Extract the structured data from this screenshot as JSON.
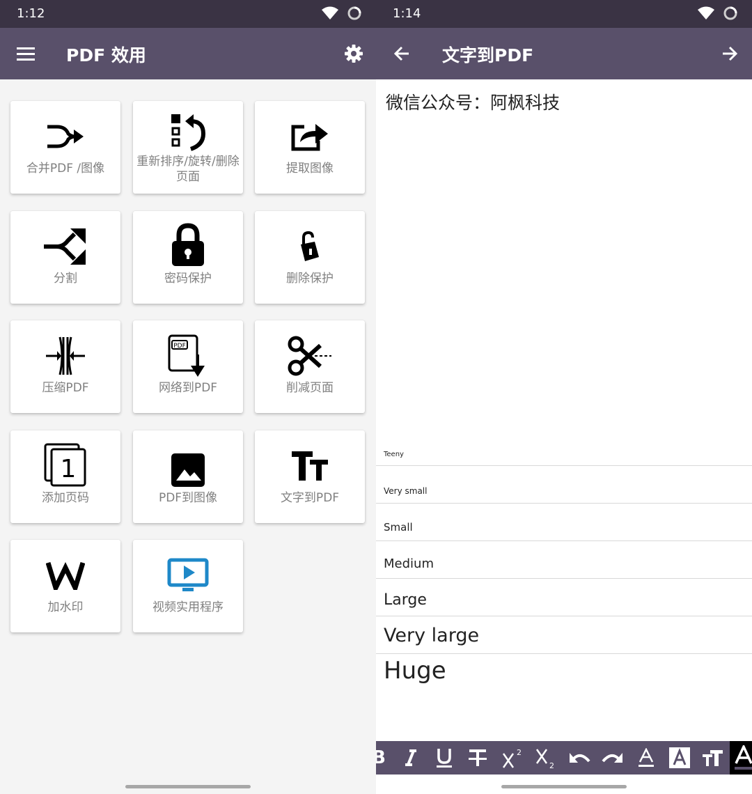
{
  "left_screen": {
    "status": {
      "time": "1:12"
    },
    "appbar": {
      "title": "PDF 效用"
    },
    "tiles": [
      {
        "label": "合并PDF /图像",
        "icon": "merge-icon"
      },
      {
        "label": "重新排序/旋转/删除页面",
        "icon": "reorder-rotate-icon"
      },
      {
        "label": "提取图像",
        "icon": "share-icon"
      },
      {
        "label": "分割",
        "icon": "split-icon"
      },
      {
        "label": "密码保护",
        "icon": "lock-icon"
      },
      {
        "label": "删除保护",
        "icon": "unlock-icon"
      },
      {
        "label": "压缩PDF",
        "icon": "compress-icon"
      },
      {
        "label": "网络到PDF",
        "icon": "pdf-download-icon"
      },
      {
        "label": "削减页面",
        "icon": "scissors-icon"
      },
      {
        "label": "添加页码",
        "icon": "page-number-icon"
      },
      {
        "label": "PDF到图像",
        "icon": "image-icon"
      },
      {
        "label": "文字到PDF",
        "icon": "text-size-icon"
      },
      {
        "label": "加水印",
        "icon": "watermark-icon"
      },
      {
        "label": "视频实用程序",
        "icon": "tv-play-icon"
      }
    ]
  },
  "right_screen": {
    "status": {
      "time": "1:14"
    },
    "appbar": {
      "title": "文字到PDF"
    },
    "editor": {
      "text": "微信公众号：阿枫科技"
    },
    "font_sizes": [
      "Teeny",
      "Very small",
      "Small",
      "Medium",
      "Large",
      "Very large",
      "Huge"
    ],
    "toolbar": [
      "bold",
      "italic",
      "underline",
      "strikethrough",
      "superscript",
      "subscript",
      "undo",
      "redo",
      "text-color",
      "text-background",
      "text-size",
      "font"
    ]
  },
  "colors": {
    "appbar": "#59506a",
    "statusbar": "#3a3344",
    "tile_label": "#808080",
    "tv_icon": "#1e88c8"
  }
}
